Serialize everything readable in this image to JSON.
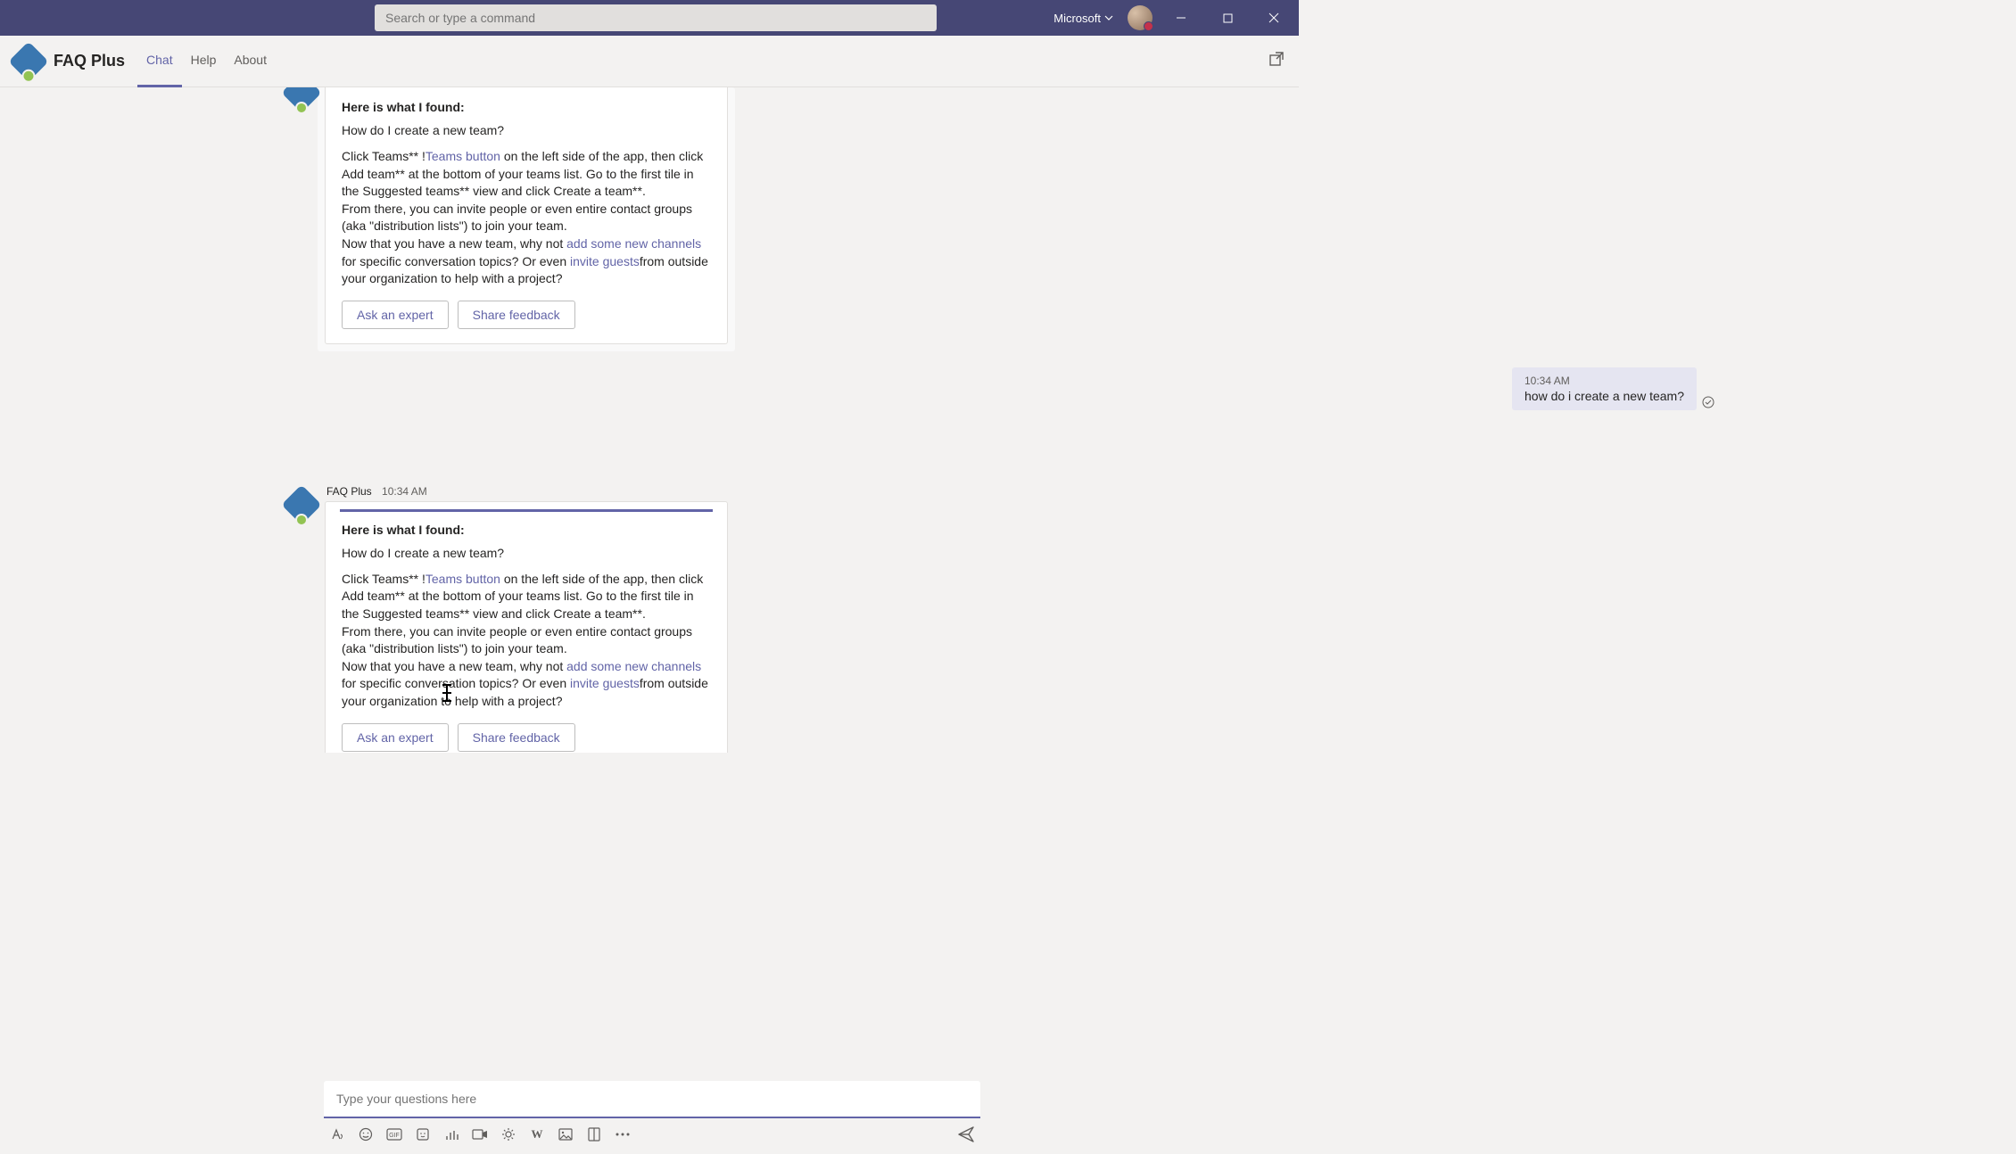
{
  "titlebar": {
    "search_placeholder": "Search or type a command",
    "org": "Microsoft"
  },
  "app": {
    "title": "FAQ Plus",
    "tabs": {
      "chat": "Chat",
      "help": "Help",
      "about": "About"
    }
  },
  "card1": {
    "heading": "Here is what I found:",
    "question": "How do I create a new team?",
    "p1_a": "Click Teams** !",
    "link1": "Teams button",
    "p1_b": " on the left side of the app, then click Add team** at the bottom of your teams list. Go to the first tile in the Suggested teams** view and click Create a team**.",
    "p2": "From there, you can invite people or even entire contact groups (aka \"distribution lists\") to join your team.",
    "p3_a": "Now that you have a new team, why not ",
    "link2": "add some new channels",
    "p3_b": " for specific conversation topics? Or even ",
    "link3": "invite guests",
    "p3_c": "from outside your organization to help with a project?",
    "btn1": "Ask an expert",
    "btn2": "Share feedback"
  },
  "user_msg": {
    "time": "10:34 AM",
    "text": "how do i create a new team?"
  },
  "card2_meta": {
    "name": "FAQ Plus",
    "time": "10:34 AM"
  },
  "compose": {
    "placeholder": "Type your questions here"
  }
}
